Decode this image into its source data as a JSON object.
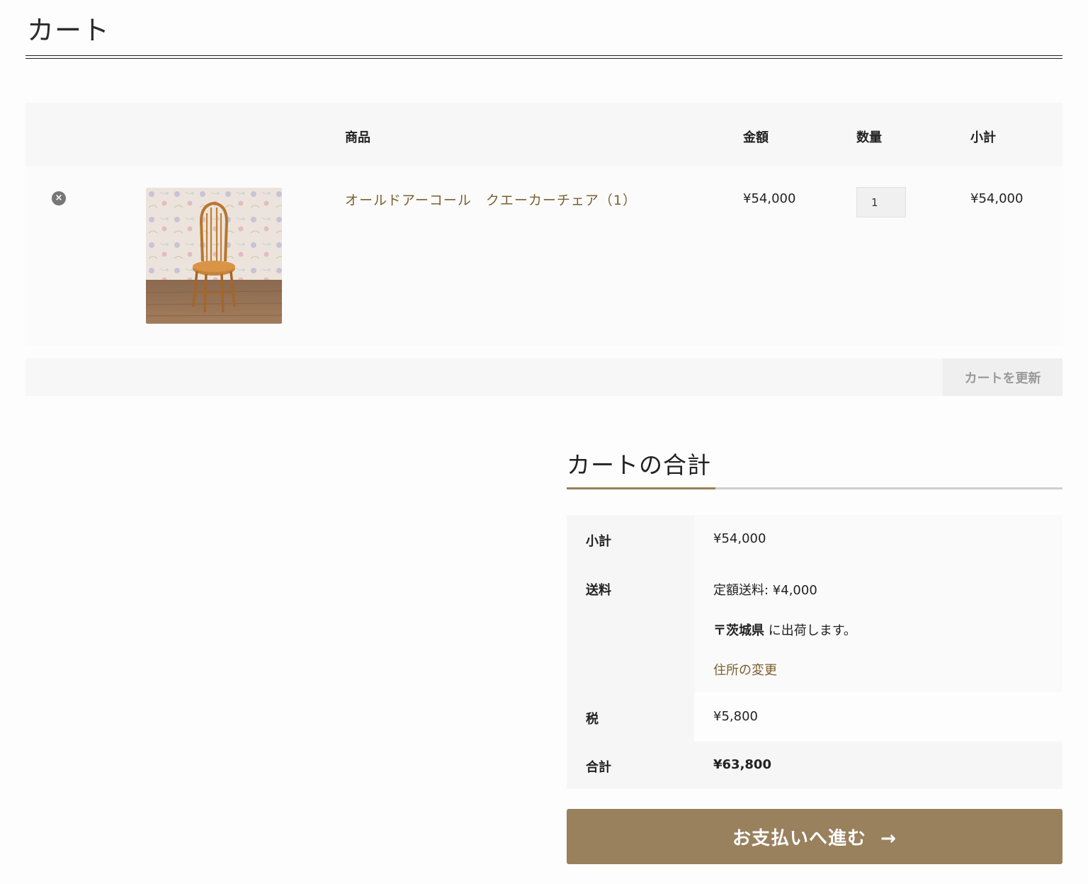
{
  "page": {
    "title": "カート"
  },
  "cart_table": {
    "headers": {
      "product": "商品",
      "price": "金額",
      "quantity": "数量",
      "subtotal": "小計"
    },
    "items": [
      {
        "remove_icon": "close-circle-icon",
        "remove_glyph": "×",
        "name": "オールドアーコール　クエーカーチェア（1）",
        "price": "¥54,000",
        "quantity": "1",
        "subtotal": "¥54,000"
      }
    ],
    "update_button": "カートを更新"
  },
  "totals": {
    "title": "カートの合計",
    "rows": {
      "subtotal_label": "小計",
      "subtotal_value": "¥54,000",
      "shipping_label": "送料",
      "shipping_method": "定額送料: ¥4,000",
      "shipping_destination_bold": "〒茨城県",
      "shipping_destination_rest": " に出荷します。",
      "change_address": "住所の変更",
      "tax_label": "税",
      "tax_value": "¥5,800",
      "total_label": "合計",
      "total_value": "¥63,800"
    },
    "checkout_button": "お支払いへ進む",
    "checkout_arrow": "→"
  },
  "colors": {
    "accent": "#99815e",
    "link": "#7a5f2e"
  }
}
